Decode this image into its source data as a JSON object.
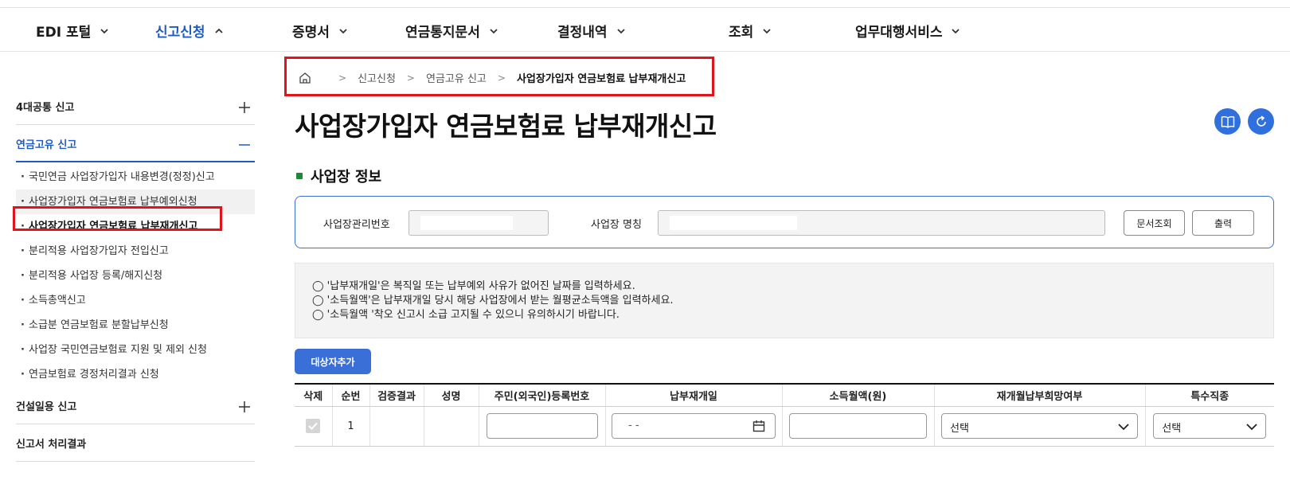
{
  "topnav": {
    "items": [
      {
        "label": "EDI 포털",
        "expanded": false
      },
      {
        "label": "신고신청",
        "expanded": true,
        "active": true
      },
      {
        "label": "증명서",
        "expanded": false
      },
      {
        "label": "연금통지문서",
        "expanded": false
      },
      {
        "label": "결정내역",
        "expanded": false
      },
      {
        "label": "조회",
        "expanded": false
      },
      {
        "label": "업무대행서비스",
        "expanded": false
      }
    ]
  },
  "sidebar": {
    "sections": [
      {
        "label": "4대공통 신고",
        "toggle": "plus"
      },
      {
        "label": "연금고유 신고",
        "toggle": "minus"
      },
      {
        "label": "건설일용 신고",
        "toggle": "plus"
      },
      {
        "label": "신고서 처리결과"
      }
    ],
    "sub_items": [
      "국민연금 사업장가입자 내용변경(정정)신고",
      "사업장가입자 연금보험료 납부예외신청",
      "사업장가입자 연금보험료 납부재개신고",
      "분리적용 사업장가입자 전입신고",
      "분리적용 사업장 등록/해지신청",
      "소득총액신고",
      "소급분 연금보험료 분할납부신청",
      "사업장 국민연금보험료 지원 및 제외 신청",
      "연금보험료 경정처리결과 신청"
    ],
    "current_index": 2
  },
  "breadcrumb": {
    "home_icon": "home-icon",
    "items": [
      "신고신청",
      "연금고유 신고",
      "사업장가입자 연금보험료 납부재개신고"
    ]
  },
  "page": {
    "title": "사업장가입자 연금보험료 납부재개신고",
    "icons": [
      "book-icon",
      "refresh-icon"
    ]
  },
  "workplace": {
    "section_title": "사업장 정보",
    "mgmt_no_label": "사업장관리번호",
    "mgmt_no_value": "",
    "name_label": "사업장 명칭",
    "name_value": "",
    "lookup_button": "문서조회",
    "print_button": "출력"
  },
  "notice": {
    "lines": [
      "◯ '납부재개일'은 복직일 또는 납부예외 사유가 없어진 날짜를 입력하세요.",
      "◯ '소득월액'은 납부재개일 당시 해당 사업장에서 받는 월평균소득액을 입력하세요.",
      "◯ '소득월액 '착오 신고시 소급 고지될 수 있으니 유의하시기 바랍니다."
    ]
  },
  "add_button": "대상자추가",
  "table": {
    "headers": [
      "삭제",
      "순번",
      "검증결과",
      "성명",
      "주민(외국인)등록번호",
      "납부재개일",
      "소득월액(원)",
      "재개월납부희망여부",
      "특수직종"
    ],
    "row": {
      "seq": "1",
      "resume_date_placeholder": "- -",
      "resume_flag_select": "선택",
      "special_job_select": "선택"
    }
  },
  "colors": {
    "accent": "#1f5bc4",
    "button_blue": "#3a6fd8",
    "highlight_red": "#e0141a",
    "section_dot": "#1d8a3a"
  }
}
